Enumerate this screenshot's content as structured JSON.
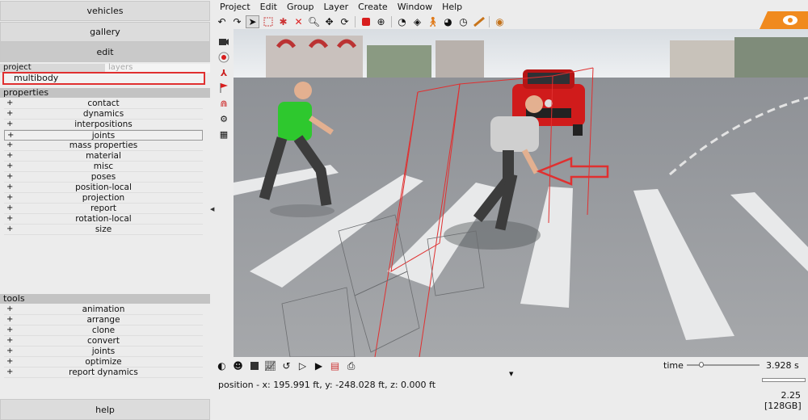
{
  "left_nav": {
    "vehicles": "vehicles",
    "gallery": "gallery",
    "edit": "edit",
    "help": "help"
  },
  "tabs": {
    "project": "project",
    "layers": "layers"
  },
  "selected_object": "multibody",
  "properties": {
    "header": "properties",
    "items": [
      "contact",
      "dynamics",
      "interpositions",
      "joints",
      "mass properties",
      "material",
      "misc",
      "poses",
      "position-local",
      "projection",
      "report",
      "rotation-local",
      "size"
    ]
  },
  "tools": {
    "header": "tools",
    "items": [
      "animation",
      "arrange",
      "clone",
      "convert",
      "joints",
      "optimize",
      "report dynamics"
    ]
  },
  "menu": [
    "Project",
    "Edit",
    "Group",
    "Layer",
    "Create",
    "Window",
    "Help"
  ],
  "icons": {
    "toolbar": [
      "undo-icon",
      "redo-icon",
      "select-pointer-icon",
      "select-box-icon",
      "move-target-icon",
      "delete-x-icon",
      "zoom-icon",
      "pan-cross-icon",
      "rotate-icon",
      "camera-icon",
      "walking-person-icon",
      "measure-icon",
      "ruler-icon",
      "settings-icon"
    ],
    "side": [
      "camera-view-icon",
      "record-icon",
      "axes-icon",
      "flag-icon",
      "magnet-icon",
      "gears-icon",
      "grid-icon"
    ]
  },
  "colors": {
    "accent_red": "#e03030",
    "logo_orange": "#f08a1e",
    "shirt_green": "#2ec82e"
  },
  "time": {
    "label": "time",
    "value": "3.928 s",
    "fraction": 0.2
  },
  "status": {
    "position": "position - x: 195.991 ft, y: -248.028 ft, z: 0.000 ft",
    "version": "2.25",
    "memory": "[128GB]"
  },
  "plus": "+"
}
